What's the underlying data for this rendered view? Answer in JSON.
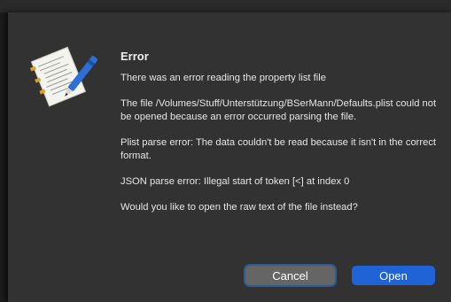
{
  "dialog": {
    "title": "Error",
    "message": "There was an error reading the property list file",
    "details": [
      "The file /Volumes/Stuff/Unterstützung/BSerMann/Defaults.plist could not be opened because an error occurred parsing the file.",
      "Plist parse error: The data couldn't be read because it isn't in the correct format.",
      "JSON parse error: Illegal start of token [<] at index 0",
      "Would you like to open the raw text of the file instead?"
    ],
    "icon": "document-with-pen-icon",
    "buttons": {
      "cancel": "Cancel",
      "open": "Open"
    }
  },
  "colors": {
    "sheet_background": "#323232",
    "primary_button": "#1f63d6",
    "secondary_button": "#656565",
    "focus_ring": "#2d5b93"
  }
}
